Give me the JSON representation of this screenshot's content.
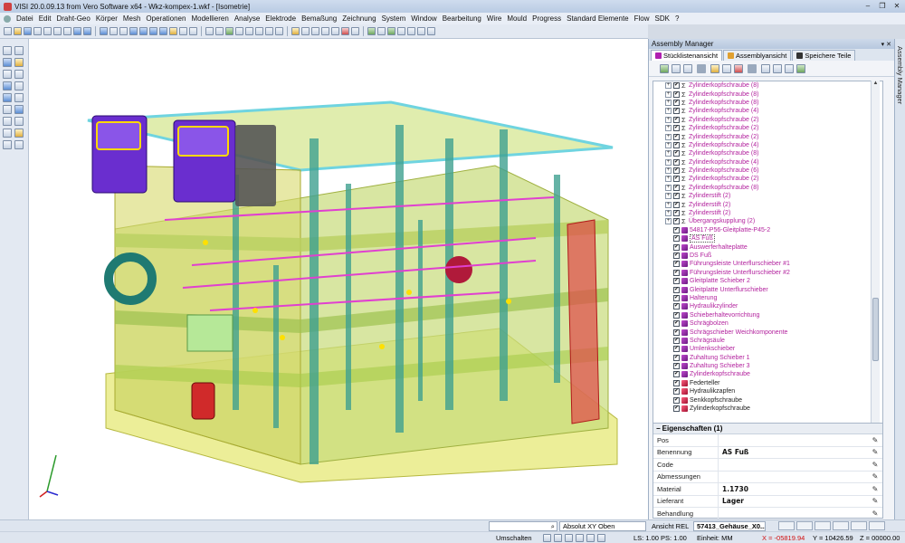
{
  "window": {
    "title": "VISI 20.0.09.13 from Vero Software x64 - Wkz-kompex-1.wkf - [Isometrie]",
    "minimize": "–",
    "restore": "❐",
    "close": "✕"
  },
  "menu": [
    "Datei",
    "Edit",
    "Draht-Geo",
    "Körper",
    "Mesh",
    "Operationen",
    "Modellieren",
    "Analyse",
    "Elektrode",
    "Bemaßung",
    "Zeichnung",
    "System",
    "Window",
    "Bearbeitung",
    "Wire",
    "Mould",
    "Progress",
    "Standard Elemente",
    "Flow",
    "SDK",
    "?"
  ],
  "panel": {
    "title": "Assembly Manager",
    "pin": "▾ ✕",
    "tabs": [
      "Stücklistenansicht",
      "Assemblyansicht",
      "Speichere Teile"
    ],
    "sidebar_label": "Assembly Manager"
  },
  "tree": [
    {
      "label": "Zylinderkopfschraube (8)",
      "kind": "group"
    },
    {
      "label": "Zylinderkopfschraube (8)",
      "kind": "group"
    },
    {
      "label": "Zylinderkopfschraube (8)",
      "kind": "group"
    },
    {
      "label": "Zylinderkopfschraube (4)",
      "kind": "group"
    },
    {
      "label": "Zylinderkopfschraube (2)",
      "kind": "group"
    },
    {
      "label": "Zylinderkopfschraube (2)",
      "kind": "group"
    },
    {
      "label": "Zylinderkopfschraube (2)",
      "kind": "group"
    },
    {
      "label": "Zylinderkopfschraube (4)",
      "kind": "group"
    },
    {
      "label": "Zylinderkopfschraube (8)",
      "kind": "group"
    },
    {
      "label": "Zylinderkopfschraube (4)",
      "kind": "group"
    },
    {
      "label": "Zylinderkopfschraube (6)",
      "kind": "group"
    },
    {
      "label": "Zylinderkopfschraube (2)",
      "kind": "group"
    },
    {
      "label": "Zylinderkopfschraube (8)",
      "kind": "group"
    },
    {
      "label": "Zylinderstift (2)",
      "kind": "group"
    },
    {
      "label": "Zylinderstift (2)",
      "kind": "group"
    },
    {
      "label": "Zylinderstift (2)",
      "kind": "group"
    },
    {
      "label": "Übergangskupplung (2)",
      "kind": "group"
    },
    {
      "label": "54817-P56-Gleitplatte-P45-2",
      "kind": "item"
    },
    {
      "label": "AS Fuß",
      "kind": "item",
      "selected": true
    },
    {
      "label": "Auswerferhalteplatte",
      "kind": "item"
    },
    {
      "label": "DS Fuß",
      "kind": "item"
    },
    {
      "label": "Führungsleiste Unterflurschieber #1",
      "kind": "item"
    },
    {
      "label": "Führungsleiste Unterflurschieber #2",
      "kind": "item"
    },
    {
      "label": "Gleitplatte Schieber 2",
      "kind": "item"
    },
    {
      "label": "Gleitplatte Unterflurschieber",
      "kind": "item"
    },
    {
      "label": "Halterung",
      "kind": "item"
    },
    {
      "label": "Hydraulikzylinder",
      "kind": "item"
    },
    {
      "label": "Schieberhaltevorrichtung",
      "kind": "item"
    },
    {
      "label": "Schrägbolzen",
      "kind": "item"
    },
    {
      "label": "Schrägschieber Weichkomponente",
      "kind": "item"
    },
    {
      "label": "Schrägsäule",
      "kind": "item"
    },
    {
      "label": "Umlenkschieber",
      "kind": "item"
    },
    {
      "label": "Zuhaltung Schieber 1",
      "kind": "item"
    },
    {
      "label": "Zuhaltung Schieber 3",
      "kind": "item"
    },
    {
      "label": "Zylinderkopfschraube",
      "kind": "item"
    },
    {
      "label": "Federteller",
      "kind": "part"
    },
    {
      "label": "Hydraulikzapfen",
      "kind": "part"
    },
    {
      "label": "Senkkopfschraube",
      "kind": "part"
    },
    {
      "label": "Zylinderkopfschraube",
      "kind": "part"
    }
  ],
  "properties": {
    "title": "Eigenschaften (1)",
    "rows": [
      {
        "key": "Pos",
        "value": ""
      },
      {
        "key": "Benennung",
        "value": "AS Fuß"
      },
      {
        "key": "Code",
        "value": ""
      },
      {
        "key": "Abmessungen",
        "value": ""
      },
      {
        "key": "Material",
        "value": "1.1730"
      },
      {
        "key": "Lieferant",
        "value": "Lager"
      },
      {
        "key": "Behandlung",
        "value": ""
      }
    ]
  },
  "status": {
    "search_placeholder": "",
    "view_mode": "Absolut XY Oben",
    "view_label": "Ansicht REL",
    "part_name": "57413_Gehäuse_X0...",
    "switch": "Umschalten",
    "ls_ps": "LS: 1.00 PS: 1.00",
    "units": "Einheit: MM",
    "coord_x": "X = -05819.94",
    "coord_y": "Y = 10426.59",
    "coord_z": "Z = 00000.00"
  }
}
